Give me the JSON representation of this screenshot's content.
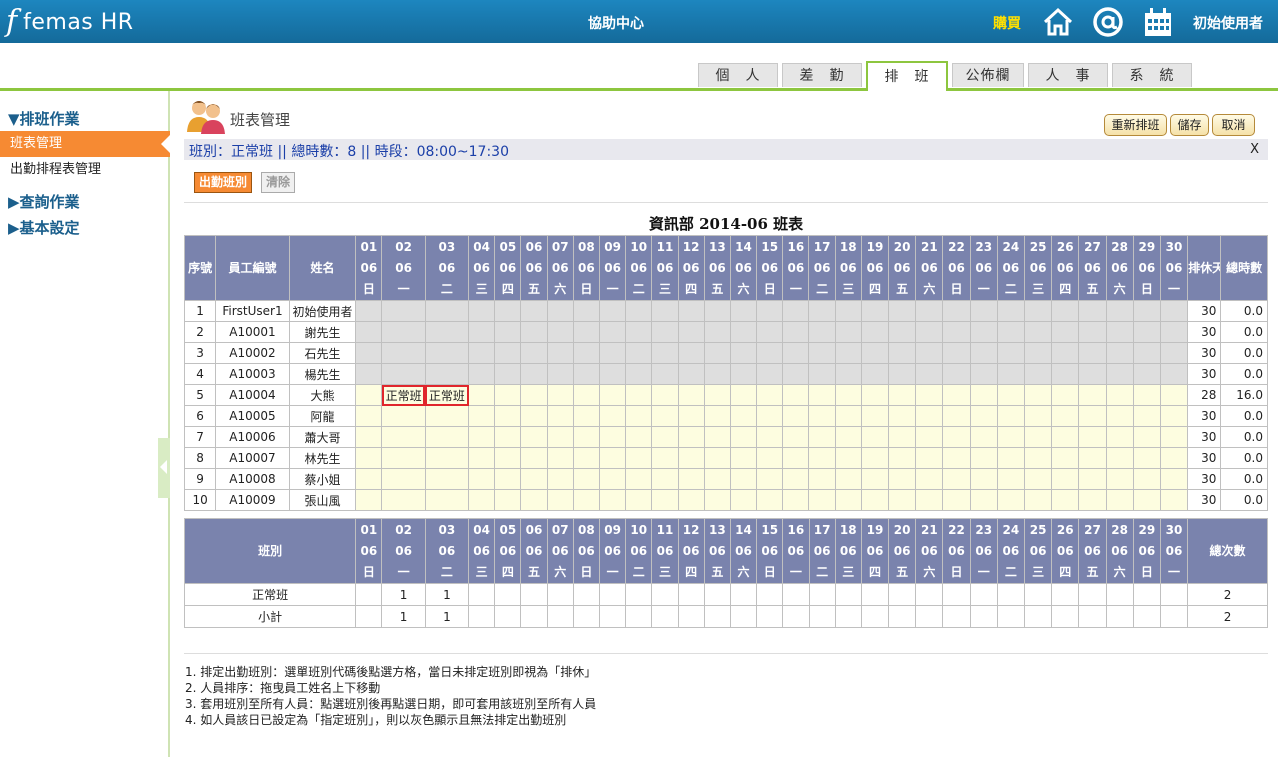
{
  "header": {
    "logo_mark": "f",
    "logo_text": "femas HR",
    "help_center": "協助中心",
    "buy": "購買",
    "user": "初始使用者",
    "icons": [
      "home-icon",
      "at-icon",
      "calendar-icon"
    ]
  },
  "tabs": [
    "個　人",
    "差　勤",
    "排　班",
    "公佈欄",
    "人　事",
    "系　統"
  ],
  "active_tab": "排　班",
  "sidebar": {
    "section1": "▼排班作業",
    "items": [
      "班表管理",
      "出勤排程表管理"
    ],
    "section2": "▶查詢作業",
    "section3": "▶基本設定"
  },
  "page": {
    "title": "班表管理",
    "buttons": {
      "reschedule": "重新排班",
      "save": "儲存",
      "cancel": "取消"
    },
    "info": "班別：正常班 || 總時數：8 || 時段：08:00~17:30",
    "close": "X",
    "shift_btn": "出勤班別",
    "clear_btn": "清除",
    "schedule_title": "資訊部 2014-06 班表"
  },
  "table": {
    "headers": {
      "seq": "序號",
      "emp_id": "員工編號",
      "name": "姓名",
      "rest_days": "排休天數",
      "total_hours": "總時數"
    },
    "days": [
      "01",
      "02",
      "03",
      "04",
      "05",
      "06",
      "07",
      "08",
      "09",
      "10",
      "11",
      "12",
      "13",
      "14",
      "15",
      "16",
      "17",
      "18",
      "19",
      "20",
      "21",
      "22",
      "23",
      "24",
      "25",
      "26",
      "27",
      "28",
      "29",
      "30"
    ],
    "month": "06",
    "weekdays": [
      "日",
      "一",
      "二",
      "三",
      "四",
      "五",
      "六",
      "日",
      "一",
      "二",
      "三",
      "四",
      "五",
      "六",
      "日",
      "一",
      "二",
      "三",
      "四",
      "五",
      "六",
      "日",
      "一",
      "二",
      "三",
      "四",
      "五",
      "六",
      "日",
      "一"
    ],
    "rows": [
      {
        "seq": "1",
        "id": "FirstUser1",
        "name": "初始使用者",
        "gray": true,
        "cells": {},
        "rest": "30",
        "hours": "0.0"
      },
      {
        "seq": "2",
        "id": "A10001",
        "name": "謝先生",
        "gray": true,
        "cells": {},
        "rest": "30",
        "hours": "0.0"
      },
      {
        "seq": "3",
        "id": "A10002",
        "name": "石先生",
        "gray": true,
        "cells": {},
        "rest": "30",
        "hours": "0.0"
      },
      {
        "seq": "4",
        "id": "A10003",
        "name": "楊先生",
        "gray": true,
        "cells": {},
        "rest": "30",
        "hours": "0.0"
      },
      {
        "seq": "5",
        "id": "A10004",
        "name": "大熊",
        "gray": false,
        "cells": {
          "1": "正常班",
          "2": "正常班"
        },
        "rest": "28",
        "hours": "16.0"
      },
      {
        "seq": "6",
        "id": "A10005",
        "name": "阿龍",
        "gray": false,
        "cells": {},
        "rest": "30",
        "hours": "0.0"
      },
      {
        "seq": "7",
        "id": "A10006",
        "name": "蕭大哥",
        "gray": false,
        "cells": {},
        "rest": "30",
        "hours": "0.0"
      },
      {
        "seq": "8",
        "id": "A10007",
        "name": "林先生",
        "gray": false,
        "cells": {},
        "rest": "30",
        "hours": "0.0"
      },
      {
        "seq": "9",
        "id": "A10008",
        "name": "蔡小姐",
        "gray": false,
        "cells": {},
        "rest": "30",
        "hours": "0.0"
      },
      {
        "seq": "10",
        "id": "A10009",
        "name": "張山風",
        "gray": false,
        "cells": {},
        "rest": "30",
        "hours": "0.0"
      }
    ]
  },
  "summary": {
    "header_shift": "班別",
    "header_total": "總次數",
    "rows": [
      {
        "label": "正常班",
        "cells": {
          "1": "1",
          "2": "1"
        },
        "total": "2"
      },
      {
        "label": "小計",
        "cells": {
          "1": "1",
          "2": "1"
        },
        "total": "2"
      }
    ]
  },
  "notes": [
    "1. 排定出勤班別：選單班別代碼後點選方格，當日未排定班別即視為「排休」",
    "2. 人員排序：拖曳員工姓名上下移動",
    "3. 套用班別至所有人員：點選班別後再點選日期，即可套用該班別至所有人員",
    "4. 如人員該日已設定為「指定班別」，則以灰色顯示且無法排定出勤班別"
  ],
  "colors": {
    "header_bg": "#1a7bb0",
    "accent_green": "#8dc63f",
    "active_orange": "#f68a33",
    "table_header": "#7a83ad",
    "buy": "#ffe000"
  }
}
